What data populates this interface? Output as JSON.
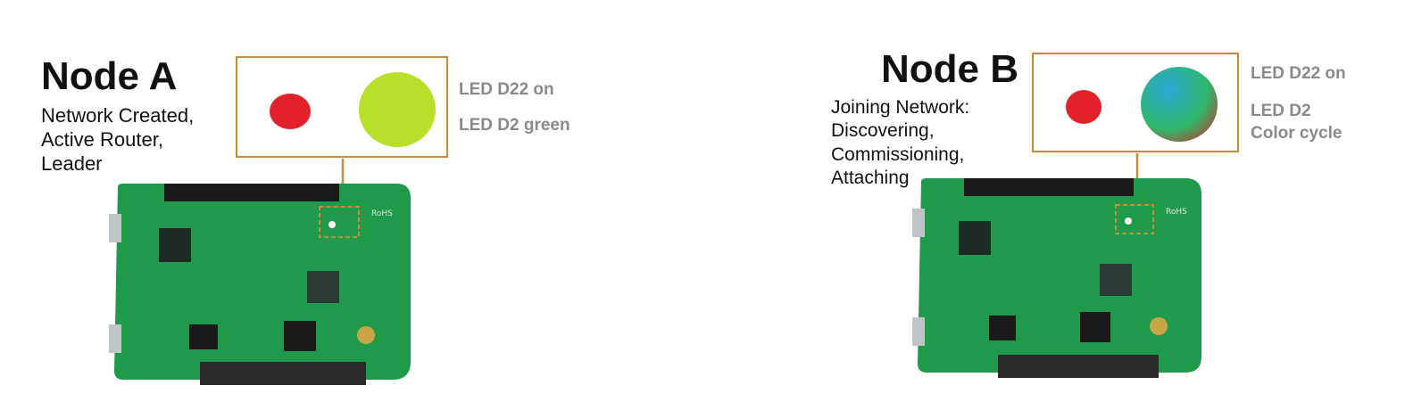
{
  "node_a": {
    "title": "Node A",
    "status_lines": [
      "Network Created,",
      "Active Router,",
      "Leader"
    ],
    "led_labels": [
      "LED D22 on",
      "LED D2 green"
    ],
    "led_d22_color": "#e3212b",
    "led_d2_color": "#b8e02a",
    "board_silkscreen": [
      "RoHS"
    ]
  },
  "node_b": {
    "title": "Node B",
    "status_lines": [
      "Joining Network:",
      "Discovering,",
      "Commissioning,",
      "Attaching"
    ],
    "led_labels": [
      "LED D22 on",
      "LED D2",
      "Color cycle"
    ],
    "led_d22_color": "#e3212b",
    "led_d2_colors": [
      "#2aa8d8",
      "#2fb86a",
      "#d02a2a"
    ],
    "board_silkscreen": [
      "RoHS"
    ]
  },
  "colors": {
    "callout_border": "#c98a3a",
    "board_green": "#1f9a4a",
    "header_black": "#1a1a1a"
  }
}
